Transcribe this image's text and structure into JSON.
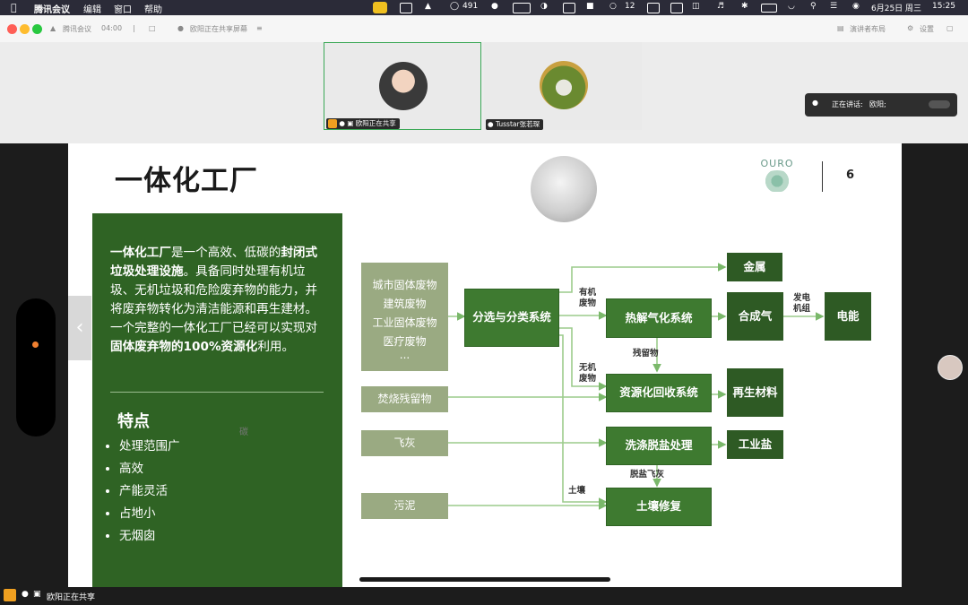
{
  "menubar": {
    "app": "腾讯会议",
    "menus": [
      "编辑",
      "窗口",
      "帮助"
    ],
    "status": {
      "notif_count": "491",
      "wechat_count": "12",
      "date": "6月25日 周三",
      "time": "15:25"
    }
  },
  "titlebar": {
    "brand": "腾讯会议",
    "timer": "04:00",
    "share_status": "欧阳正在共享屏幕",
    "right_btn1": "演讲者布局",
    "right_btn2": "设置"
  },
  "participants": [
    {
      "name": "欧阳正在共享"
    },
    {
      "name": "Tusstar张若琛"
    }
  ],
  "speaking": {
    "label": "正在讲话:",
    "name": "欧阳;"
  },
  "slide": {
    "title": "一体化工厂",
    "page": "6",
    "logo": "OURO",
    "intro_parts": [
      {
        "t": "一体化工厂",
        "b": true
      },
      {
        "t": "是一个高效、低碳的",
        "b": false
      },
      {
        "t": "封闭式垃圾处理设施",
        "b": true
      },
      {
        "t": "。具备同时处理有机垃圾、无机垃圾和危险废弃物的能力，并将废弃物转化为清洁能源和再生建材。 一个完整的一体化工厂已经可以实现对",
        "b": false
      },
      {
        "t": "固体废弃物的100%资源化",
        "b": true
      },
      {
        "t": "利用。",
        "b": false
      }
    ],
    "features_title": "特点",
    "features": [
      "处理范围广",
      "高效",
      "产能灵活",
      "占地小",
      "无烟囱"
    ],
    "stray": "碳",
    "flow": {
      "inputs": [
        "城市固体废物",
        "建筑废物",
        "工业固体废物",
        "医疗废物",
        "..."
      ],
      "sort": "分选与分类系统",
      "pyro": "热解气化系统",
      "recovery": "资源化回收系统",
      "wash": "洗涤脱盐处理",
      "soil": "土壤修复",
      "metal": "金属",
      "syngas": "合成气",
      "power": "电能",
      "material": "再生材料",
      "salt": "工业盐",
      "ash_bottom": "焚烧残留物",
      "fly_ash": "飞灰",
      "sludge": "污泥",
      "lbl_organic": "有机\n废物",
      "lbl_inorganic": "无机\n废物",
      "lbl_residue": "残留物",
      "lbl_generator": "发电\n机组",
      "lbl_desalt": "脱盐飞灰",
      "lbl_soil": "土壤"
    }
  },
  "bottombar": {
    "share_status": "欧阳正在共享"
  }
}
